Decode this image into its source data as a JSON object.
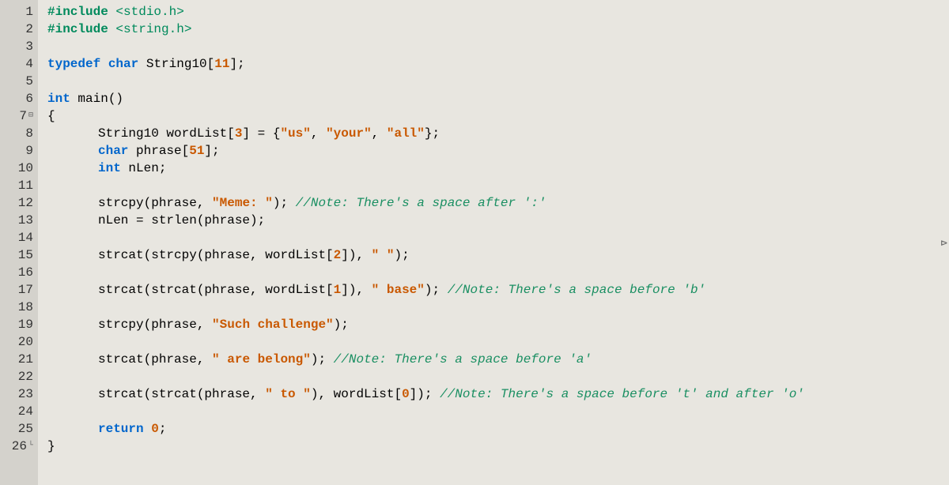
{
  "gutter": {
    "lines": [
      "1",
      "2",
      "3",
      "4",
      "5",
      "6",
      "7",
      "8",
      "9",
      "10",
      "11",
      "12",
      "13",
      "14",
      "15",
      "16",
      "17",
      "18",
      "19",
      "20",
      "21",
      "22",
      "23",
      "24",
      "25",
      "26"
    ],
    "foldMarkers": {
      "7": "⊟",
      "26": "└"
    }
  },
  "code": {
    "l1": {
      "a": "#include",
      "b": " ",
      "c": "<stdio.h>"
    },
    "l2": {
      "a": "#include",
      "b": " ",
      "c": "<string.h>"
    },
    "l3": "",
    "l4": {
      "a": "typedef",
      "b": " ",
      "c": "char",
      "d": " String10[",
      "e": "11",
      "f": "];"
    },
    "l5": "",
    "l6": {
      "a": "int",
      "b": " main()"
    },
    "l7": "{",
    "l8": {
      "a": "String10 wordList[",
      "b": "3",
      "c": "] = {",
      "d": "\"us\"",
      "e": ", ",
      "f": "\"your\"",
      "g": ", ",
      "h": "\"all\"",
      "i": "};"
    },
    "l9": {
      "a": "char",
      "b": " phrase[",
      "c": "51",
      "d": "];"
    },
    "l10": {
      "a": "int",
      "b": " nLen;"
    },
    "l11": "",
    "l12": {
      "a": "strcpy(phrase, ",
      "b": "\"Meme: \"",
      "c": "); ",
      "d": "//Note: There's a space after ':'"
    },
    "l13": {
      "a": "nLen = strlen(phrase);"
    },
    "l14": "",
    "l15": {
      "a": "strcat(strcpy(phrase, wordList[",
      "b": "2",
      "c": "]), ",
      "d": "\" \"",
      "e": ");"
    },
    "l16": "",
    "l17": {
      "a": "strcat(strcat(phrase, wordList[",
      "b": "1",
      "c": "]), ",
      "d": "\" base\"",
      "e": "); ",
      "f": "//Note: There's a space before 'b'"
    },
    "l18": "",
    "l19": {
      "a": "strcpy(phrase, ",
      "b": "\"Such challenge\"",
      "c": ");"
    },
    "l20": "",
    "l21": {
      "a": "strcat(phrase, ",
      "b": "\" are belong\"",
      "c": "); ",
      "d": "//Note: There's a space before 'a'"
    },
    "l22": "",
    "l23": {
      "a": "strcat(strcat(phrase, ",
      "b": "\" to \"",
      "c": "), wordList[",
      "d": "0",
      "e": "]); ",
      "f": "//Note: There's a space before 't' and after 'o'"
    },
    "l24": "",
    "l25": {
      "a": "return",
      "b": " ",
      "c": "0",
      "d": ";"
    },
    "l26": "}"
  },
  "cursorHint": "⊳"
}
